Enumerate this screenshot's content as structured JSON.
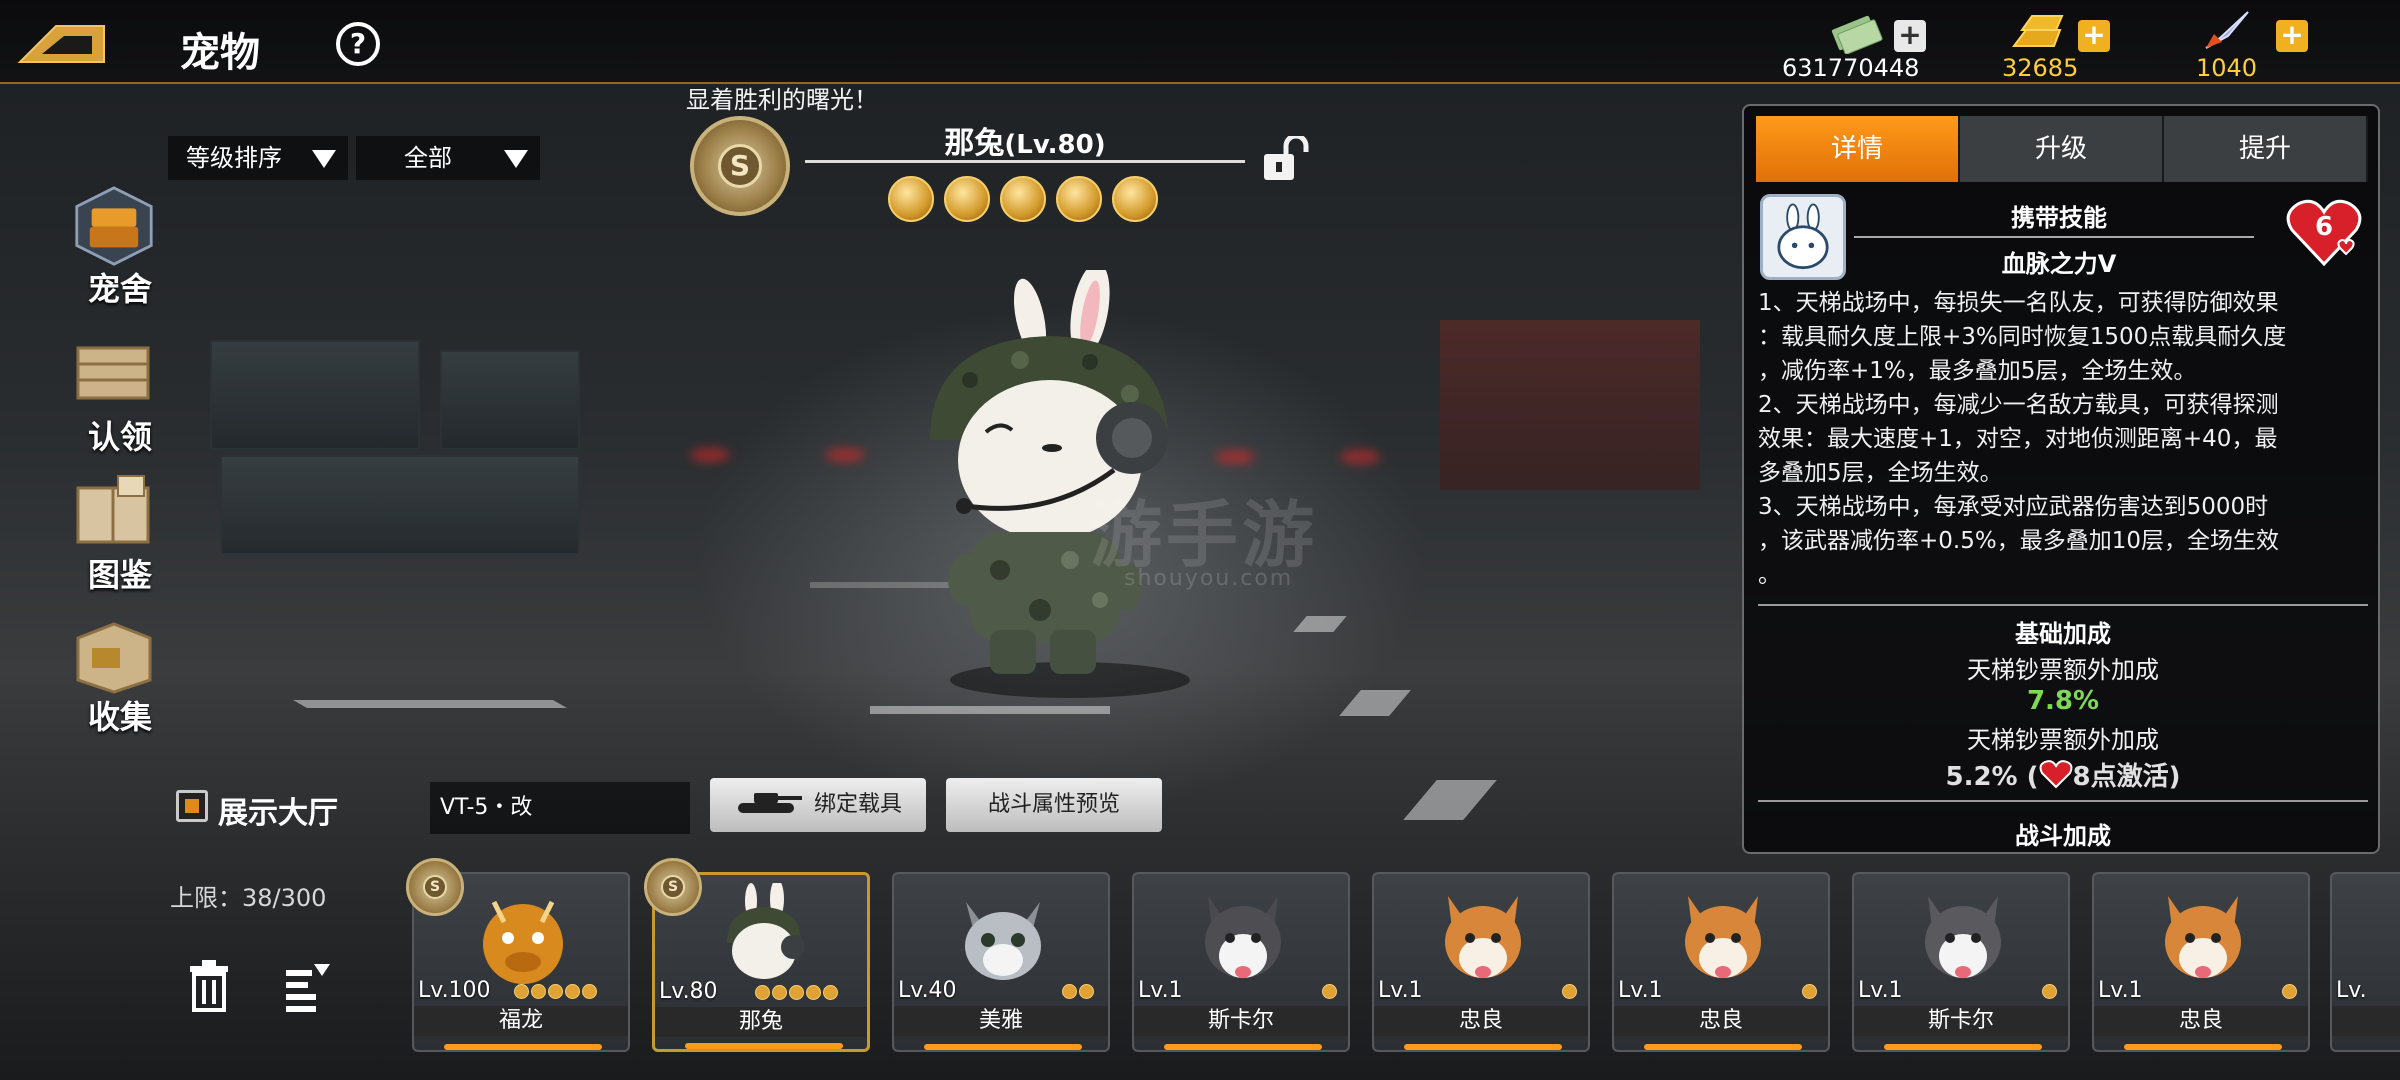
{
  "header": {
    "title": "宠物",
    "help_symbol": "?",
    "currencies": [
      {
        "icon": "cash-icon",
        "value": "631770448",
        "plus": "+"
      },
      {
        "icon": "gold-bar-icon",
        "value": "32685",
        "plus": "+"
      },
      {
        "icon": "rocket-icon",
        "value": "1040",
        "plus": "+"
      }
    ]
  },
  "filters": {
    "sort": "等级排序",
    "category": "全部"
  },
  "sidebar": {
    "items": [
      {
        "label": "宠舍",
        "icon": "kennel-icon",
        "active": true
      },
      {
        "label": "认领",
        "icon": "crate-icon"
      },
      {
        "label": "图鉴",
        "icon": "book-icon"
      },
      {
        "label": "收集",
        "icon": "box-icon"
      }
    ]
  },
  "pet": {
    "motto": "显着胜利的曙光！",
    "medal_letter": "S",
    "name": "那兔",
    "level": "(Lv.80)",
    "stars": 5,
    "tank": "VT-5・改",
    "bind_label": "绑定载具",
    "preview_label": "战斗属性预览"
  },
  "panel": {
    "tabs": [
      "详情",
      "升级",
      "提升"
    ],
    "active_tab": 0,
    "skill_title": "携带技能",
    "skill_name": "血脉之力Ⅴ",
    "heart_level": "6",
    "skill_lines": [
      "1、天梯战场中，每损失一名队友，可获得防御效果",
      "：载具耐久度上限+3%同时恢复1500点载具耐久度",
      "，减伤率+1%，最多叠加5层，全场生效。",
      "2、天梯战场中，每减少一名敌方载具，可获得探测",
      "效果：最大速度+1，对空，对地侦测距离+40，最",
      "多叠加5层，全场生效。",
      "3、天梯战场中，每承受对应武器伤害达到5000时",
      "，该武器减伤率+0.5%，最多叠加10层，全场生效",
      "。"
    ],
    "base_bonus_title": "基础加成",
    "bonus1_label": "天梯钞票额外加成",
    "bonus1_value": "7.8%",
    "bonus2_label": "天梯钞票额外加成",
    "bonus2_value": "5.2% (",
    "bonus2_suffix": "8点激活)",
    "battle_bonus_title": "战斗加成",
    "colors": {
      "active_tab": "#ff9a1a",
      "bonus_green": "#7ed957"
    }
  },
  "bottom": {
    "show_hall": "展示大厅",
    "capacity": "上限：38/300"
  },
  "cards": [
    {
      "lv": "Lv.100",
      "name": "福龙",
      "stars": 5,
      "medal": true,
      "kind": "dragon"
    },
    {
      "lv": "Lv.80",
      "name": "那兔",
      "stars": 5,
      "medal": true,
      "kind": "rabbit",
      "selected": true
    },
    {
      "lv": "Lv.40",
      "name": "美雅",
      "stars": 2,
      "kind": "cat"
    },
    {
      "lv": "Lv.1",
      "name": "斯卡尔",
      "stars": 1,
      "kind": "husky"
    },
    {
      "lv": "Lv.1",
      "name": "忠良",
      "stars": 1,
      "kind": "shiba"
    },
    {
      "lv": "Lv.1",
      "name": "忠良",
      "stars": 1,
      "kind": "shiba"
    },
    {
      "lv": "Lv.1",
      "name": "斯卡尔",
      "stars": 1,
      "kind": "husky"
    },
    {
      "lv": "Lv.1",
      "name": "忠良",
      "stars": 1,
      "kind": "shiba"
    },
    {
      "lv": "Lv.",
      "name": "",
      "stars": 0,
      "kind": "partial"
    }
  ],
  "watermark": {
    "main": "游手游",
    "sub": "shouyou.com"
  }
}
